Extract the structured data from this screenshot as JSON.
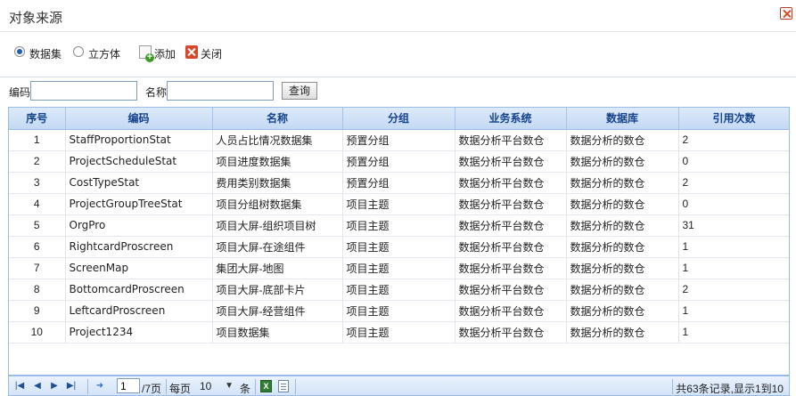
{
  "dialog": {
    "title": "对象来源"
  },
  "toolbar": {
    "radio_dataset": "数据集",
    "radio_cube": "立方体",
    "add_label": "添加",
    "close_label": "关闭"
  },
  "search": {
    "code_label": "编码",
    "code_value": "",
    "name_label": "名称",
    "name_value": "",
    "query_button": "查询"
  },
  "grid": {
    "columns": [
      "序号",
      "编码",
      "名称",
      "分组",
      "业务系统",
      "数据库",
      "引用次数"
    ],
    "rows": [
      [
        "1",
        "StaffProportionStat",
        "人员占比情况数据集",
        "预置分组",
        "数据分析平台数仓",
        "数据分析的数仓",
        "2"
      ],
      [
        "2",
        "ProjectScheduleStat",
        "项目进度数据集",
        "预置分组",
        "数据分析平台数仓",
        "数据分析的数仓",
        "0"
      ],
      [
        "3",
        "CostTypeStat",
        "费用类别数据集",
        "预置分组",
        "数据分析平台数仓",
        "数据分析的数仓",
        "2"
      ],
      [
        "4",
        "ProjectGroupTreeStat",
        "项目分组树数据集",
        "项目主题",
        "数据分析平台数仓",
        "数据分析的数仓",
        "0"
      ],
      [
        "5",
        "OrgPro",
        "项目大屏-组织项目树",
        "项目主题",
        "数据分析平台数仓",
        "数据分析的数仓",
        "31"
      ],
      [
        "6",
        "RightcardProscreen",
        "项目大屏-在途组件",
        "项目主题",
        "数据分析平台数仓",
        "数据分析的数仓",
        "1"
      ],
      [
        "7",
        "ScreenMap",
        "集团大屏-地图",
        "项目主题",
        "数据分析平台数仓",
        "数据分析的数仓",
        "1"
      ],
      [
        "8",
        "BottomcardProscreen",
        "项目大屏-底部卡片",
        "项目主题",
        "数据分析平台数仓",
        "数据分析的数仓",
        "2"
      ],
      [
        "9",
        "LeftcardProscreen",
        "项目大屏-经营组件",
        "项目主题",
        "数据分析平台数仓",
        "数据分析的数仓",
        "1"
      ],
      [
        "10",
        "Project1234",
        "项目数据集",
        "项目主题",
        "数据分析平台数仓",
        "数据分析的数仓",
        "1"
      ]
    ]
  },
  "pager": {
    "current_page": "1",
    "total_pages_label": "/7页",
    "per_page_label": "每页",
    "per_page_value": "10",
    "per_page_unit": "条",
    "info": "共63条记录,显示1到10"
  }
}
